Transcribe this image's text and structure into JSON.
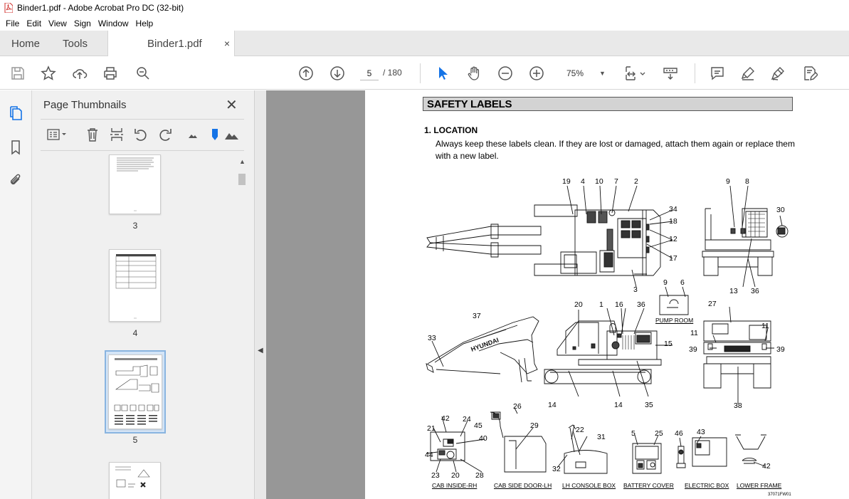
{
  "window": {
    "title": "Binder1.pdf - Adobe Acrobat Pro DC (32-bit)"
  },
  "menu": [
    "File",
    "Edit",
    "View",
    "Sign",
    "Window",
    "Help"
  ],
  "tabs": {
    "home": "Home",
    "tools": "Tools",
    "document": "Binder1.pdf",
    "close_glyph": "×"
  },
  "toolbar": {
    "page_current": "5",
    "page_total": "/ 180",
    "zoom": "75%",
    "icons": [
      "save-icon",
      "bookmark-star-icon",
      "upload-icon",
      "print-icon",
      "search-zoom-icon",
      "prev-page-icon",
      "next-page-icon",
      "select-arrow-icon",
      "hand-icon",
      "zoom-out-icon",
      "zoom-in-icon",
      "page-fit-icon",
      "scroll-mode-icon",
      "comment-icon",
      "highlight-icon",
      "sign-icon",
      "edit-pdf-icon"
    ],
    "accent": "#1473e6"
  },
  "panel": {
    "title": "Page Thumbnails",
    "close_glyph": "✕",
    "thumbnails": [
      {
        "label": "3",
        "selected": false
      },
      {
        "label": "4",
        "selected": false
      },
      {
        "label": "5",
        "selected": true
      },
      {
        "label": "",
        "selected": false
      }
    ]
  },
  "document": {
    "header": "SAFETY LABELS",
    "section": "1.  LOCATION",
    "paragraph": "Always keep these labels clean.  If they are lost or damaged, attach them again or replace them with a new label.",
    "figure_code": "37071FW01",
    "captions": [
      "PUMP ROOM",
      "CAB INSIDE-RH",
      "CAB SIDE DOOR-LH",
      "LH CONSOLE BOX",
      "BATTERY COVER",
      "ELECTRIC BOX",
      "LOWER FRAME"
    ],
    "callouts": {
      "top_view": [
        "19",
        "4",
        "10",
        "7",
        "2",
        "34",
        "18",
        "12",
        "17",
        "3"
      ],
      "rear_top": [
        "9",
        "8",
        "30",
        "13",
        "36"
      ],
      "pump": [
        "9",
        "6"
      ],
      "side": [
        "37",
        "20",
        "1",
        "16",
        "36",
        "33",
        "15",
        "14",
        "14",
        "35"
      ],
      "rear_view": [
        "27",
        "11",
        "11",
        "39",
        "39",
        "38"
      ],
      "details": [
        "42",
        "24",
        "45",
        "21",
        "40",
        "44",
        "23",
        "20",
        "28",
        "26",
        "29",
        "22",
        "31",
        "32",
        "5",
        "25",
        "46",
        "43",
        "42"
      ]
    }
  }
}
